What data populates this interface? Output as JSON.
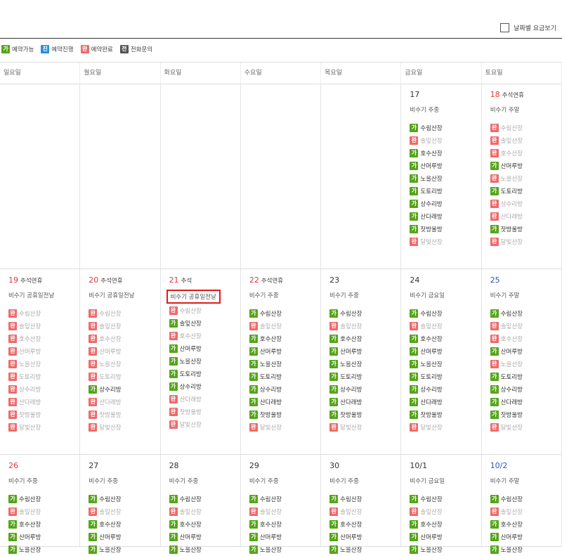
{
  "header": {
    "date_price_view_label": "날짜별 요금보기"
  },
  "legend": [
    {
      "badge": "가",
      "cls": "b-ga",
      "label": "예약가능"
    },
    {
      "badge": "진",
      "cls": "b-jin",
      "label": "예약진행"
    },
    {
      "badge": "완",
      "cls": "b-wan",
      "label": "예약완료"
    },
    {
      "badge": "전",
      "cls": "b-jeon",
      "label": "전화문의"
    }
  ],
  "weekdays": [
    "일요일",
    "월요일",
    "화요일",
    "수요일",
    "목요일",
    "금요일",
    "토요일"
  ],
  "rooms": [
    "수림산장",
    "솔잎산장",
    "호수산장",
    "산머루방",
    "노을산장",
    "도토리방",
    "상수리방",
    "산다래방",
    "잣방울방",
    "달빛산장"
  ],
  "weeks": [
    [
      null,
      null,
      null,
      null,
      null,
      {
        "day": "17",
        "holiday": "",
        "season": "비수기 주중",
        "status": [
          "가",
          "완",
          "가",
          "가",
          "가",
          "가",
          "가",
          "가",
          "가",
          "완"
        ]
      },
      {
        "day": "18",
        "holiday": "추석연휴",
        "season": "비수기 주말",
        "status": [
          "완",
          "완",
          "완",
          "가",
          "완",
          "가",
          "완",
          "완",
          "가",
          "완"
        ]
      }
    ],
    [
      {
        "day": "19",
        "holiday": "추석연휴",
        "season": "비수기 공휴일전날",
        "status": [
          "완",
          "완",
          "완",
          "완",
          "완",
          "완",
          "완",
          "완",
          "완",
          "완"
        ]
      },
      {
        "day": "20",
        "holiday": "추석연휴",
        "season": "비수기 공휴일전날",
        "status": [
          "완",
          "완",
          "완",
          "완",
          "완",
          "완",
          "가",
          "완",
          "완",
          "완"
        ]
      },
      {
        "day": "21",
        "holiday": "추석",
        "season": "비수기 공휴일전날",
        "highlight": true,
        "status": [
          "완",
          "가",
          "완",
          "가",
          "가",
          "가",
          "가",
          "완",
          "완",
          "완"
        ]
      },
      {
        "day": "22",
        "holiday": "추석연휴",
        "season": "비수기 주중",
        "status": [
          "가",
          "완",
          "가",
          "가",
          "가",
          "가",
          "가",
          "가",
          "가",
          "완"
        ]
      },
      {
        "day": "23",
        "holiday": "",
        "season": "비수기 주중",
        "status": [
          "가",
          "완",
          "가",
          "가",
          "가",
          "가",
          "가",
          "가",
          "가",
          "완"
        ]
      },
      {
        "day": "24",
        "holiday": "",
        "season": "비수기 금요일",
        "status": [
          "가",
          "완",
          "가",
          "가",
          "가",
          "가",
          "가",
          "가",
          "가",
          "완"
        ]
      },
      {
        "day": "25",
        "holiday": "",
        "season": "비수기 주말",
        "status": [
          "가",
          "완",
          "완",
          "가",
          "완",
          "가",
          "가",
          "가",
          "가",
          "완"
        ]
      }
    ],
    [
      {
        "day": "26",
        "holiday": "",
        "season": "비수기 주중",
        "status": [
          "가",
          "완",
          "가",
          "가",
          "가"
        ]
      },
      {
        "day": "27",
        "holiday": "",
        "season": "비수기 주중",
        "status": [
          "가",
          "완",
          "가",
          "가",
          "가"
        ]
      },
      {
        "day": "28",
        "holiday": "",
        "season": "비수기 주중",
        "status": [
          "가",
          "완",
          "가",
          "가",
          "가"
        ]
      },
      {
        "day": "29",
        "holiday": "",
        "season": "비수기 주중",
        "status": [
          "가",
          "완",
          "가",
          "가",
          "가"
        ]
      },
      {
        "day": "30",
        "holiday": "",
        "season": "비수기 주중",
        "status": [
          "가",
          "완",
          "가",
          "가",
          "가"
        ]
      },
      {
        "day": "10/1",
        "holiday": "",
        "season": "비수기 금요일",
        "status": [
          "가",
          "완",
          "가",
          "가",
          "가"
        ]
      },
      {
        "day": "10/2",
        "holiday": "",
        "season": "비수기 주말",
        "status": [
          "가",
          "완",
          "가",
          "가",
          "가"
        ]
      }
    ]
  ]
}
